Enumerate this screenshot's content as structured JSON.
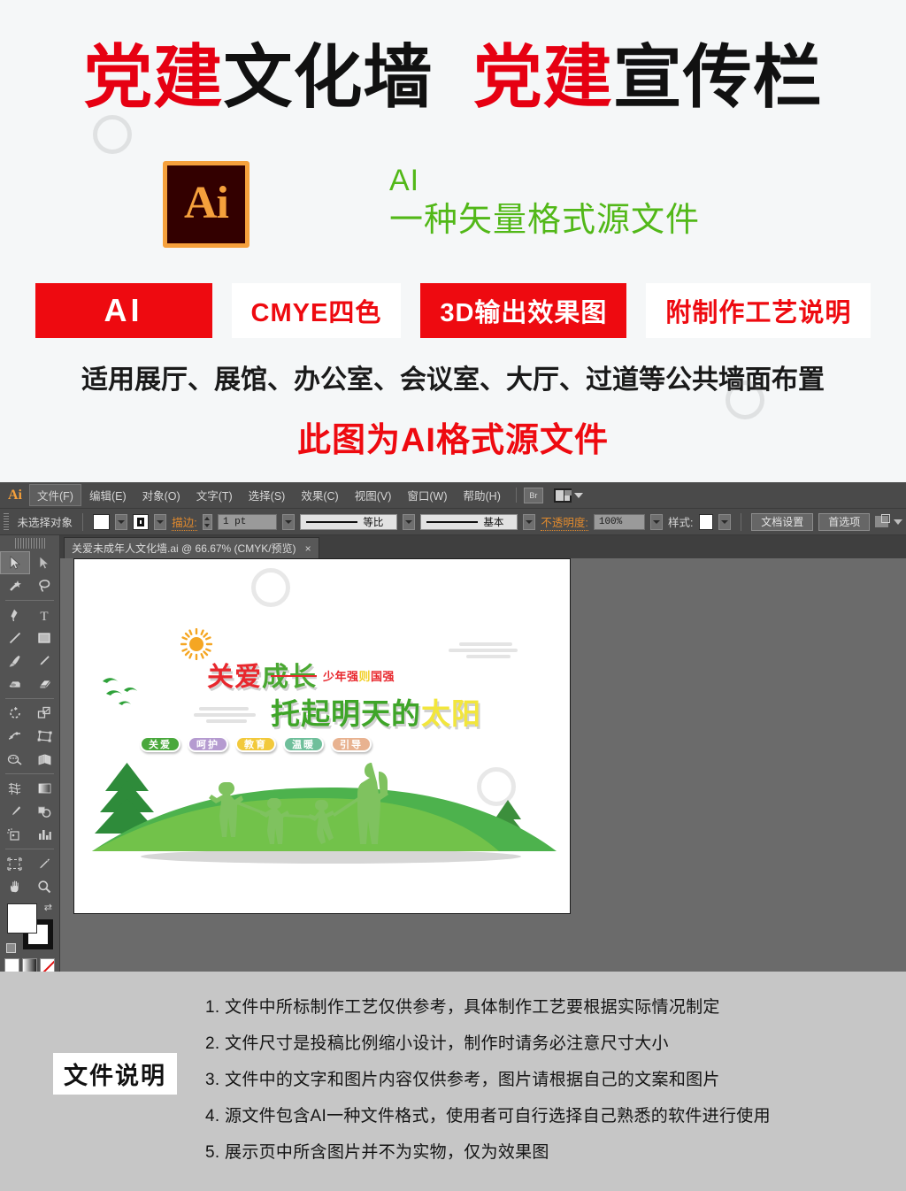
{
  "promo": {
    "title_parts": [
      {
        "text": "党建",
        "color": "red"
      },
      {
        "text": "文化墙",
        "color": "black"
      },
      {
        "text": " ",
        "color": "black"
      },
      {
        "text": "党建",
        "color": "red"
      },
      {
        "text": "宣传栏",
        "color": "black"
      }
    ],
    "title_red_1": "党建",
    "title_black_1": "文化墙",
    "title_red_2": "党建",
    "title_black_2": "宣传栏",
    "ai_logo_text": "Ai",
    "green_ai_label": "AI",
    "green_description": "一种矢量格式源文件",
    "badges": [
      {
        "label": "AI",
        "style": "red-fill"
      },
      {
        "label": "CMYE四色",
        "style": "white-fill"
      },
      {
        "label": "3D输出效果图",
        "style": "red-fill"
      },
      {
        "label": "附制作工艺说明",
        "style": "white-fill"
      }
    ],
    "apply_line": "适用展厅、展馆、办公室、会议室、大厅、过道等公共墙面布置",
    "source_line": "此图为AI格式源文件",
    "colors": {
      "red": "#ee0a10",
      "green": "#52b818",
      "logo_orange": "#f5a03c",
      "logo_brown": "#330000"
    }
  },
  "illustrator": {
    "app_logo": "Ai",
    "menus": [
      {
        "label": "文件(F)",
        "active": true
      },
      {
        "label": "编辑(E)",
        "active": false
      },
      {
        "label": "对象(O)",
        "active": false
      },
      {
        "label": "文字(T)",
        "active": false
      },
      {
        "label": "选择(S)",
        "active": false
      },
      {
        "label": "效果(C)",
        "active": false
      },
      {
        "label": "视图(V)",
        "active": false
      },
      {
        "label": "窗口(W)",
        "active": false
      },
      {
        "label": "帮助(H)",
        "active": false
      }
    ],
    "bridge_button": "Br",
    "options_bar": {
      "selection_status": "未选择对象",
      "stroke_label": "描边:",
      "stroke_width": "1 pt",
      "profile_value": "等比",
      "brush_value": "基本",
      "opacity_label": "不透明度:",
      "opacity_value": "100%",
      "style_label": "样式:",
      "document_setup_button": "文档设置",
      "preferences_button": "首选项"
    },
    "document_tab": {
      "title": "关爱未成年人文化墙.ai @ 66.67% (CMYK/预览)",
      "close_glyph": "×"
    },
    "toolbox": {
      "tools": [
        "selection-tool",
        "direct-selection-tool",
        "magic-wand-tool",
        "lasso-tool",
        "pen-tool",
        "type-tool",
        "line-segment-tool",
        "rectangle-tool",
        "paintbrush-tool",
        "pencil-tool",
        "blob-brush-tool",
        "eraser-tool",
        "rotate-tool",
        "scale-tool",
        "width-tool",
        "free-transform-tool",
        "shape-builder-tool",
        "perspective-grid-tool",
        "mesh-tool",
        "gradient-tool",
        "eyedropper-tool",
        "blend-tool",
        "symbol-sprayer-tool",
        "column-graph-tool",
        "artboard-tool",
        "slice-tool",
        "hand-tool",
        "zoom-tool"
      ],
      "fill_color": "#ffffff",
      "stroke_color": "#111111",
      "modes": [
        "color-mode",
        "gradient-mode",
        "none-mode"
      ],
      "screen_modes": [
        "normal-screen",
        "full-screen-menubar",
        "full-screen"
      ]
    },
    "artwork": {
      "headline_1_red": "关爱",
      "headline_1_green": "成长",
      "headline_2_green": "托起明天的",
      "headline_2_yellow": "太阳",
      "slogan_red_1": "少年强",
      "slogan_yellow": "则",
      "slogan_red_2": "国强",
      "tags": [
        {
          "label": "关爱",
          "color": "#49a83c"
        },
        {
          "label": "呵护",
          "color": "#b59bd0"
        },
        {
          "label": "教育",
          "color": "#f2c93b"
        },
        {
          "label": "温暖",
          "color": "#6fbf9b"
        },
        {
          "label": "引导",
          "color": "#e8b290"
        }
      ],
      "icons": [
        "sun-icon",
        "birds-icon",
        "cloud-icon",
        "pine-tree-icon",
        "family-silhouette-icon",
        "hill-icon"
      ]
    }
  },
  "notes": {
    "label": "文件说明",
    "items": [
      "1. 文件中所标制作工艺仅供参考，具体制作工艺要根据实际情况制定",
      "2. 文件尺寸是投稿比例缩小设计，制作时请务必注意尺寸大小",
      "3. 文件中的文字和图片内容仅供参考，图片请根据自己的文案和图片",
      "4. 源文件包含AI一种文件格式，使用者可自行选择自己熟悉的软件进行使用",
      "5. 展示页中所含图片并不为实物，仅为效果图"
    ]
  }
}
